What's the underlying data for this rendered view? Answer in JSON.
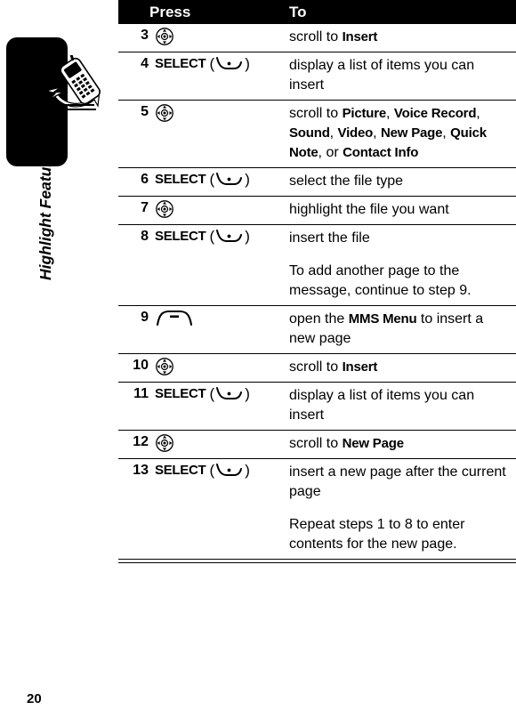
{
  "sidebar": {
    "tab_label": "Highlight Features",
    "page_number": "20",
    "phone_icon_name": "flying-phone-icon"
  },
  "table": {
    "header": {
      "press": "Press",
      "to": "To"
    },
    "rows": [
      {
        "num": "3",
        "press_icon": "nav-key-icon",
        "press_label": "",
        "to": [
          {
            "pre": "scroll to ",
            "kw": "Insert",
            "post": ""
          }
        ]
      },
      {
        "num": "4",
        "press_icon": "soft-key-icon",
        "press_label": "SELECT",
        "to": [
          {
            "pre": "display a list of items you can insert",
            "kw": "",
            "post": ""
          }
        ]
      },
      {
        "num": "5",
        "press_icon": "nav-key-icon",
        "press_label": "",
        "to": [
          {
            "pre": "scroll to ",
            "kw": "Picture",
            "post": ", "
          },
          {
            "pre": "",
            "kw": "Voice Record",
            "post": ", "
          },
          {
            "pre": "",
            "kw": "Sound",
            "post": ", "
          },
          {
            "pre": "",
            "kw": "Video",
            "post": ", "
          },
          {
            "pre": "",
            "kw": "New Page",
            "post": ", "
          },
          {
            "pre": "",
            "kw": "Quick Note",
            "post": ", or "
          },
          {
            "pre": "",
            "kw": "Contact Info",
            "post": ""
          }
        ]
      },
      {
        "num": "6",
        "press_icon": "soft-key-icon",
        "press_label": "SELECT",
        "to": [
          {
            "pre": "select the file type",
            "kw": "",
            "post": ""
          }
        ]
      },
      {
        "num": "7",
        "press_icon": "nav-key-icon",
        "press_label": "",
        "to": [
          {
            "pre": "highlight the file you want",
            "kw": "",
            "post": ""
          }
        ]
      },
      {
        "num": "8",
        "press_icon": "soft-key-icon",
        "press_label": "SELECT",
        "to": [
          {
            "pre": "insert the file",
            "kw": "",
            "post": ""
          }
        ],
        "to_second": "To add another page to the message, continue to step 9."
      },
      {
        "num": "9",
        "press_icon": "menu-key-icon",
        "press_label": "",
        "to": [
          {
            "pre": "open the ",
            "kw": "MMS Menu",
            "post": " to insert a new page"
          }
        ]
      },
      {
        "num": "10",
        "press_icon": "nav-key-icon",
        "press_label": "",
        "to": [
          {
            "pre": "scroll to ",
            "kw": "Insert",
            "post": ""
          }
        ]
      },
      {
        "num": "11",
        "press_icon": "soft-key-icon",
        "press_label": "SELECT",
        "to": [
          {
            "pre": "display a list of items you can insert",
            "kw": "",
            "post": ""
          }
        ]
      },
      {
        "num": "12",
        "press_icon": "nav-key-icon",
        "press_label": "",
        "to": [
          {
            "pre": "scroll to ",
            "kw": "New Page",
            "post": ""
          }
        ]
      },
      {
        "num": "13",
        "press_icon": "soft-key-icon",
        "press_label": "SELECT",
        "to": [
          {
            "pre": "insert a new page after the current page",
            "kw": "",
            "post": ""
          }
        ],
        "to_second": "Repeat steps 1 to 8 to enter contents for the new page."
      }
    ]
  }
}
